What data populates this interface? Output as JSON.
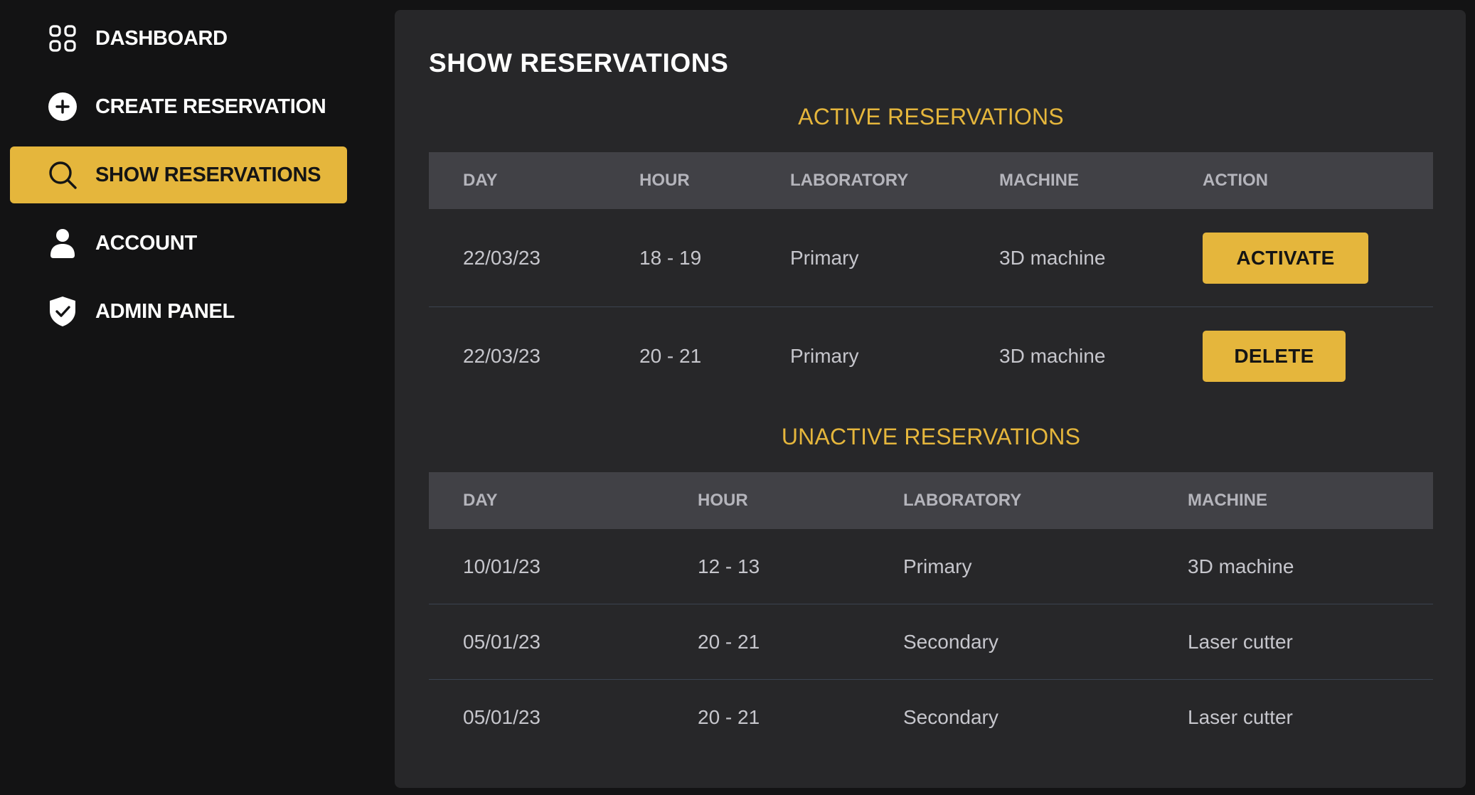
{
  "sidebar": {
    "items": [
      {
        "label": "DASHBOARD",
        "icon": "grid-icon"
      },
      {
        "label": "CREATE RESERVATION",
        "icon": "plus-circle-icon"
      },
      {
        "label": "SHOW RESERVATIONS",
        "icon": "search-icon",
        "active": true
      },
      {
        "label": "ACCOUNT",
        "icon": "user-icon"
      },
      {
        "label": "ADMIN PANEL",
        "icon": "shield-check-icon"
      }
    ]
  },
  "main": {
    "title": "SHOW RESERVATIONS",
    "active": {
      "title": "ACTIVE RESERVATIONS",
      "columns": [
        "DAY",
        "HOUR",
        "LABORATORY",
        "MACHINE",
        "ACTION"
      ],
      "rows": [
        {
          "day": "22/03/23",
          "hour": "18 - 19",
          "laboratory": "Primary",
          "machine": "3D machine",
          "action": "ACTIVATE"
        },
        {
          "day": "22/03/23",
          "hour": "20 - 21",
          "laboratory": "Primary",
          "machine": "3D machine",
          "action": "DELETE"
        }
      ]
    },
    "unactive": {
      "title": "UNACTIVE RESERVATIONS",
      "columns": [
        "DAY",
        "HOUR",
        "LABORATORY",
        "MACHINE"
      ],
      "rows": [
        {
          "day": "10/01/23",
          "hour": "12 - 13",
          "laboratory": "Primary",
          "machine": "3D machine"
        },
        {
          "day": "05/01/23",
          "hour": "20 - 21",
          "laboratory": "Secondary",
          "machine": "Laser cutter"
        },
        {
          "day": "05/01/23",
          "hour": "20 - 21",
          "laboratory": "Secondary",
          "machine": "Laser cutter"
        }
      ]
    }
  },
  "colors": {
    "accent": "#e5b63c",
    "background": "#131314",
    "panel": "#272729",
    "table_header": "#414146"
  }
}
